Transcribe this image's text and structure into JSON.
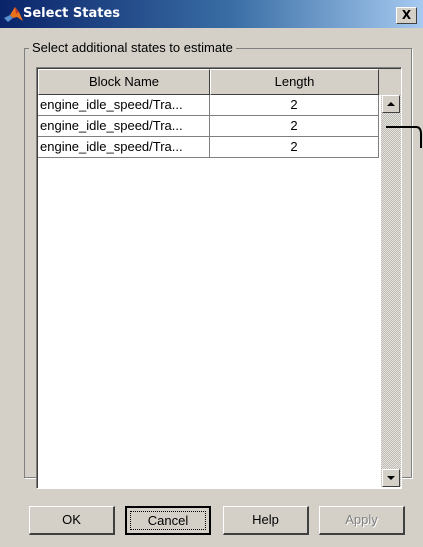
{
  "window": {
    "title": "Select States",
    "app_icon": "matlab-icon",
    "close_label": "X"
  },
  "group": {
    "title": "Select additional states to estimate"
  },
  "table": {
    "columns": [
      "Block Name",
      "Length"
    ],
    "rows": [
      {
        "block_name": "engine_idle_speed/Tra...",
        "length": "2"
      },
      {
        "block_name": "engine_idle_speed/Tra...",
        "length": "2"
      },
      {
        "block_name": "engine_idle_speed/Tra...",
        "length": "2"
      }
    ]
  },
  "scrollbar": {
    "up_icon": "scroll-up-arrow-icon",
    "down_icon": "scroll-down-arrow-icon"
  },
  "buttons": {
    "ok": "OK",
    "cancel": "Cancel",
    "help": "Help",
    "apply": "Apply"
  },
  "colors": {
    "title_bar_start": "#0a246a",
    "title_bar_end": "#a6caf0",
    "dialog_background": "#d4d0c8",
    "disabled_text": "#808080"
  }
}
